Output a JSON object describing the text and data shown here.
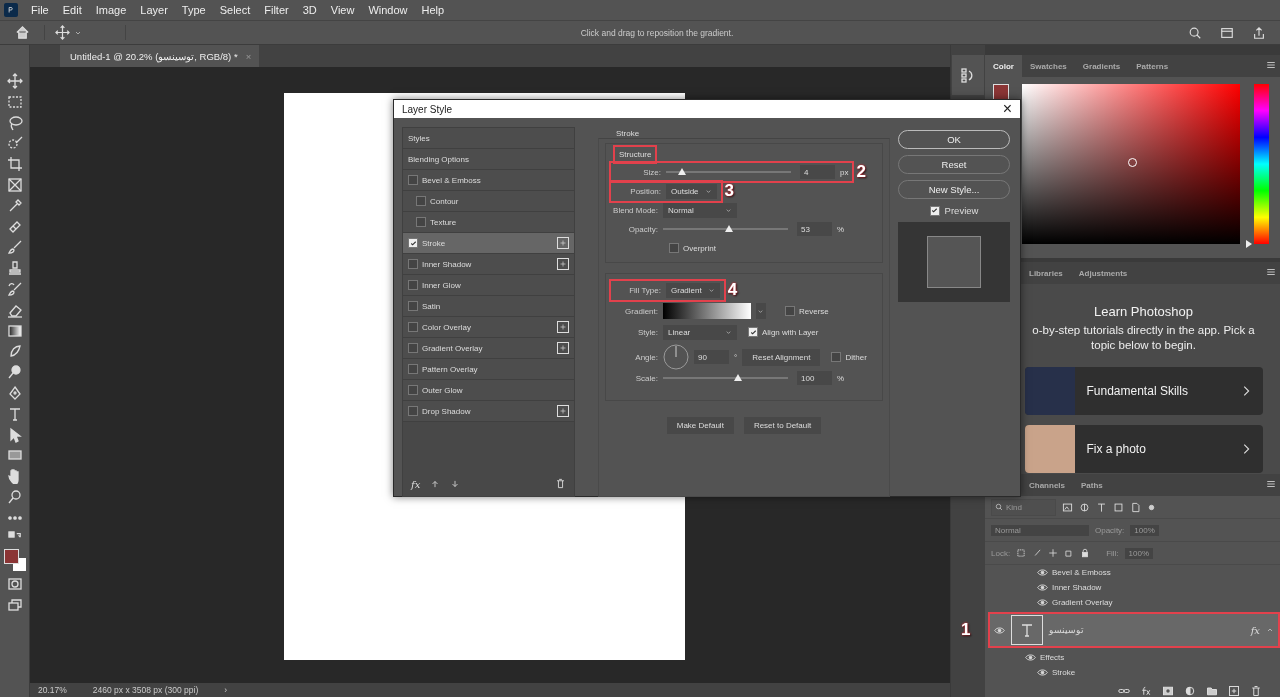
{
  "menu_bar": {
    "items": [
      "File",
      "Edit",
      "Image",
      "Layer",
      "Type",
      "Select",
      "Filter",
      "3D",
      "View",
      "Window",
      "Help"
    ]
  },
  "options_bar": {
    "hint": "Click and drag to reposition the gradient."
  },
  "document_tab": {
    "title": "Untitled-1 @ 20.2% (توسینسو, RGB/8) *",
    "close": "×"
  },
  "status_bar": {
    "zoom": "20.17%",
    "info": "2460 px x 3508 px (300 ppi)",
    "arrow": "›"
  },
  "dialog": {
    "title": "Layer Style",
    "close": "×",
    "styles": [
      {
        "label": "Styles",
        "kind": "header",
        "selected": false
      },
      {
        "label": "Blending Options",
        "kind": "header",
        "selected": false
      },
      {
        "label": "Bevel & Emboss",
        "kind": "checkbox",
        "checked": false,
        "selected": false,
        "addable": false,
        "children": [
          {
            "label": "Contour",
            "kind": "checkbox",
            "checked": false,
            "selected": false,
            "addable": false
          },
          {
            "label": "Texture",
            "kind": "checkbox",
            "checked": false,
            "selected": false,
            "addable": false
          }
        ]
      },
      {
        "label": "Stroke",
        "kind": "checkbox",
        "checked": true,
        "selected": true,
        "addable": true
      },
      {
        "label": "Inner Shadow",
        "kind": "checkbox",
        "checked": false,
        "selected": false,
        "addable": true
      },
      {
        "label": "Inner Glow",
        "kind": "checkbox",
        "checked": false,
        "selected": false,
        "addable": false
      },
      {
        "label": "Satin",
        "kind": "checkbox",
        "checked": false,
        "selected": false,
        "addable": false
      },
      {
        "label": "Color Overlay",
        "kind": "checkbox",
        "checked": false,
        "selected": false,
        "addable": true
      },
      {
        "label": "Gradient Overlay",
        "kind": "checkbox",
        "checked": false,
        "selected": false,
        "addable": true
      },
      {
        "label": "Pattern Overlay",
        "kind": "checkbox",
        "checked": false,
        "selected": false,
        "addable": false
      },
      {
        "label": "Outer Glow",
        "kind": "checkbox",
        "checked": false,
        "selected": false,
        "addable": false
      },
      {
        "label": "Drop Shadow",
        "kind": "checkbox",
        "checked": false,
        "selected": false,
        "addable": true
      }
    ],
    "fx_label": "fx",
    "section_title": "Stroke",
    "structure": {
      "title": "Structure",
      "highlighted": true,
      "rows": [
        {
          "kind": "slider",
          "label": "Size:",
          "level": 0.13,
          "value": "4",
          "unit": "px",
          "highlighted": true,
          "callout": "2"
        },
        {
          "kind": "dropdown",
          "label": "Position:",
          "value": "Outside",
          "highlighted": true,
          "callout": "3"
        },
        {
          "kind": "dropdown",
          "label": "Blend Mode:",
          "value": "Normal"
        },
        {
          "kind": "slider",
          "label": "Opacity:",
          "level": 0.53,
          "value": "53",
          "unit": "%"
        },
        {
          "kind": "checkbox",
          "label": "Overprint",
          "checked": false
        }
      ]
    },
    "fill": {
      "rows": [
        {
          "kind": "dropdown",
          "label": "Fill Type:",
          "value": "Gradient",
          "highlighted": true,
          "callout": "4"
        },
        {
          "kind": "gradient",
          "label": "Gradient:",
          "extra": {
            "label": "Reverse",
            "checked": false
          }
        },
        {
          "kind": "dropdown",
          "label": "Style:",
          "value": "Linear",
          "extra": {
            "label": "Align with Layer",
            "checked": true
          }
        },
        {
          "kind": "angle",
          "label": "Angle:",
          "value": "90",
          "unit": "°",
          "button": "Reset Alignment",
          "extra": {
            "label": "Dither",
            "checked": false
          }
        },
        {
          "kind": "slider",
          "label": "Scale:",
          "level": 0.6,
          "value": "100",
          "unit": "%"
        }
      ]
    },
    "bottom_buttons": [
      "Make Default",
      "Reset to Default"
    ],
    "side_buttons": [
      {
        "label": "OK",
        "default": true
      },
      {
        "label": "Reset",
        "default": false
      },
      {
        "label": "New Style...",
        "default": false
      }
    ],
    "preview": {
      "label": "Preview",
      "checked": true
    }
  },
  "color_panel": {
    "hue_slider": {
      "level": 0
    },
    "tabs": [
      {
        "label": "Color",
        "selected": true
      },
      {
        "label": "Swatches",
        "selected": false
      },
      {
        "label": "Gradients",
        "selected": false
      },
      {
        "label": "Patterns",
        "selected": false
      }
    ]
  },
  "learn_panel": {
    "tabs": [
      {
        "label": "Libraries",
        "selected": false
      },
      {
        "label": "Adjustments",
        "selected": false
      }
    ],
    "title": "Learn Photoshop",
    "description": "o-by-step tutorials directly in the app. Pick a topic below to begin.",
    "cards": [
      {
        "title": "Fundamental Skills"
      },
      {
        "title": "Fix a photo"
      }
    ]
  },
  "layers_panel": {
    "tabs": [
      {
        "label": "Channels",
        "selected": false
      },
      {
        "label": "Paths",
        "selected": false
      }
    ],
    "filter_placeholder": "Kind",
    "blend_mode": "Normal",
    "opacity_label": "Opacity:",
    "opacity": "100%",
    "lock_label": "Lock:",
    "fill_label": "Fill:",
    "fill": "100%",
    "controls_disabled": true,
    "rows": [
      {
        "kind": "effect",
        "label": "Bevel & Emboss"
      },
      {
        "kind": "effect",
        "label": "Inner Shadow"
      },
      {
        "kind": "effect",
        "label": "Gradient Overlay"
      },
      {
        "kind": "layer",
        "name": "توسینسو",
        "selected": true,
        "highlighted": true,
        "callout": "1",
        "fx": "fx",
        "children": [
          {
            "kind": "group",
            "label": "Effects",
            "children": [
              {
                "kind": "effect",
                "label": "Stroke"
              }
            ]
          }
        ]
      }
    ]
  }
}
